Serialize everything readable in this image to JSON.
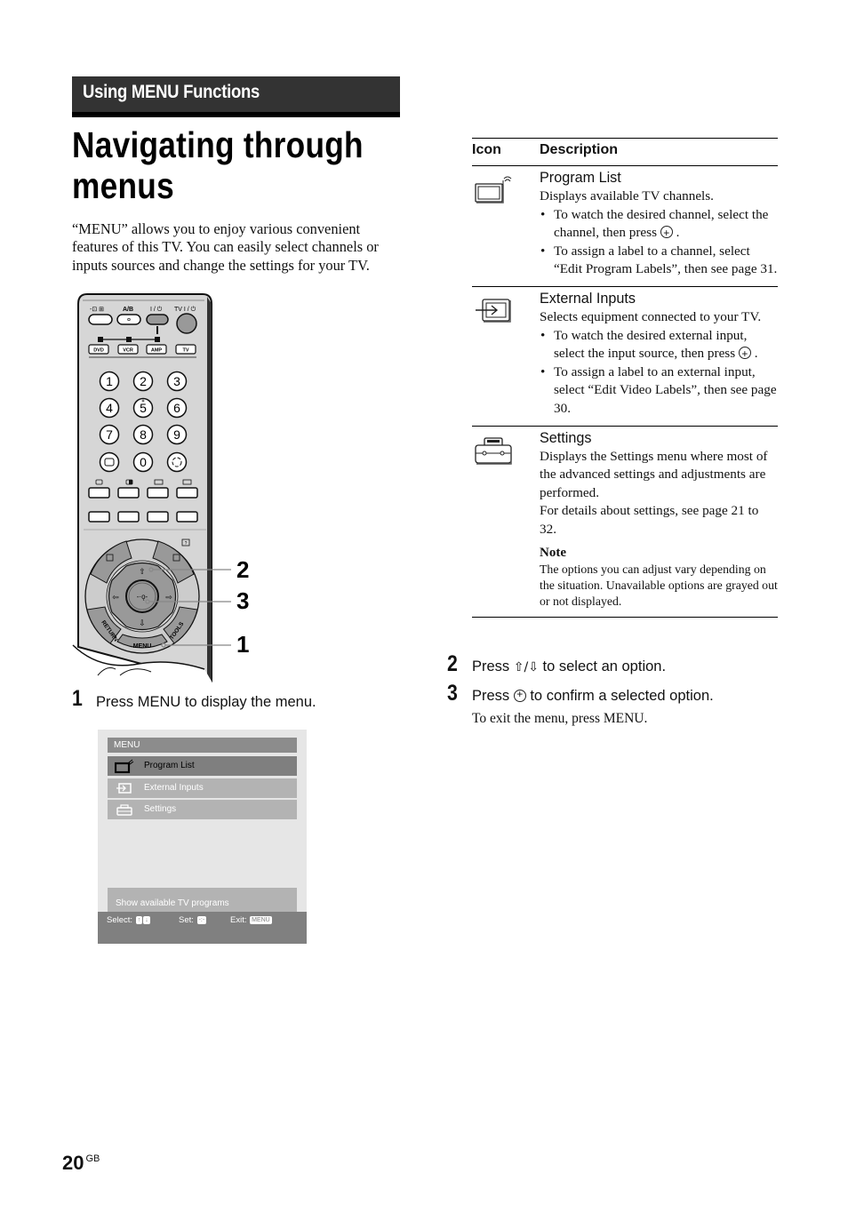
{
  "section_header": "Using MENU Functions",
  "title_line1": "Navigating through",
  "title_line2": "menus",
  "intro": "“MENU” allows you to enjoy various convenient features of this TV. You can easily select channels or inputs sources and change the settings for your TV.",
  "remote": {
    "top_labels": [
      "-⊕ ⊛",
      "A/B",
      "I / ⏻",
      "TV I / ⏻"
    ],
    "source_buttons": [
      "DVD",
      "VCR",
      "AMP",
      "TV"
    ],
    "digits": [
      "1",
      "2",
      "3",
      "4",
      "5",
      "6",
      "7",
      "8",
      "9",
      "0"
    ],
    "nav_labels": {
      "return": "RETURN",
      "tools": "TOOLS",
      "menu": "MENU"
    },
    "callouts": [
      "2",
      "3",
      "1"
    ]
  },
  "steps": [
    {
      "num": "1",
      "text": "Press MENU to display the menu."
    },
    {
      "num": "2",
      "text_before": "Press ",
      "arrows": "⇧/⇩",
      "text_after": " to select an option."
    },
    {
      "num": "3",
      "text_before": "Press ",
      "text_after": " to confirm a selected option.",
      "subtext": "To exit the menu, press MENU."
    }
  ],
  "osd": {
    "title": "MENU",
    "items": [
      {
        "label": "Program List",
        "icon": "tv-antenna-icon",
        "selected": true
      },
      {
        "label": "External Inputs",
        "icon": "input-icon",
        "selected": false
      },
      {
        "label": "Settings",
        "icon": "toolbox-icon",
        "selected": false
      }
    ],
    "hint": "Show available TV programs",
    "footer": {
      "select": "Select:",
      "set": "Set:",
      "exit": "Exit:",
      "exit_key": "MENU"
    }
  },
  "table": {
    "headers": [
      "Icon",
      "Description"
    ],
    "rows": [
      {
        "icon": "tv-antenna-icon",
        "name": "Program List",
        "summary": "Displays available TV channels.",
        "bullets": [
          {
            "text": "To watch the desired channel, select the channel, then press ",
            "has_enter": true,
            "end": "."
          },
          {
            "text": "To assign a label to a channel, select “Edit Program Labels”, then see page 31.",
            "has_enter": false,
            "end": ""
          }
        ]
      },
      {
        "icon": "input-icon",
        "name": "External Inputs",
        "summary": "Selects equipment connected to your TV.",
        "bullets": [
          {
            "text": "To watch the desired external input, select the input source, then press ",
            "has_enter": true,
            "end": "."
          },
          {
            "text": "To assign a label to an external input, select “Edit Video Labels”, then see page 30.",
            "has_enter": false,
            "end": ""
          }
        ]
      },
      {
        "icon": "toolbox-icon",
        "name": "Settings",
        "summary": "Displays the Settings menu where most of the advanced settings and adjustments are performed.",
        "summary2": "For details about settings, see page 21 to 32.",
        "note_heading": "Note",
        "note": "The options you can adjust vary depending on the situation. Unavailable options are grayed out or not displayed."
      }
    ]
  },
  "page_number": "20",
  "page_suffix": "GB"
}
